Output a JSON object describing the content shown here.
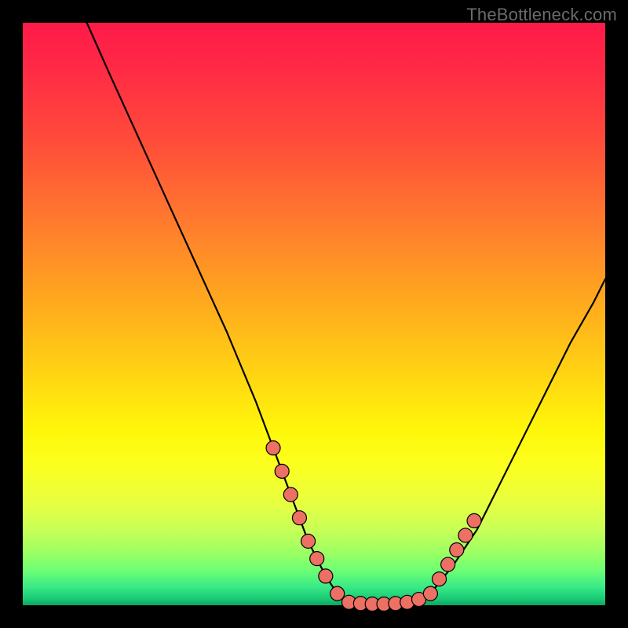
{
  "watermark": "TheBottleneck.com",
  "colors": {
    "page_bg": "#000000",
    "curve_stroke": "#000000",
    "marker_fill": "#ec7063",
    "marker_stroke": "#000000"
  },
  "chart_data": {
    "type": "line",
    "title": "",
    "xlabel": "",
    "ylabel": "",
    "xlim": [
      0,
      100
    ],
    "ylim": [
      0,
      100
    ],
    "grid": false,
    "legend": false,
    "series": [
      {
        "name": "curve",
        "x": [
          11,
          15,
          20,
          25,
          30,
          35,
          40,
          43,
          46,
          49,
          52,
          54,
          56,
          58,
          62,
          66,
          70,
          74,
          78,
          82,
          86,
          90,
          94,
          98,
          100
        ],
        "y": [
          100,
          91,
          80,
          69,
          58,
          47,
          35,
          27,
          19,
          11,
          5,
          2,
          0,
          0,
          0,
          0,
          2,
          7,
          13,
          21,
          29,
          37,
          45,
          52,
          56
        ]
      }
    ],
    "markers": {
      "name": "highlight-dots",
      "x": [
        43.0,
        44.5,
        46.0,
        47.5,
        49.0,
        50.5,
        52.0,
        54.0,
        56.0,
        58.0,
        60.0,
        62.0,
        64.0,
        66.0,
        68.0,
        70.0,
        71.5,
        73.0,
        74.5,
        76.0,
        77.5
      ],
      "y": [
        27.0,
        23.0,
        19.0,
        15.0,
        11.0,
        8.0,
        5.0,
        2.0,
        0.5,
        0.3,
        0.2,
        0.2,
        0.3,
        0.5,
        1.0,
        2.0,
        4.5,
        7.0,
        9.5,
        12.0,
        14.5
      ]
    }
  }
}
